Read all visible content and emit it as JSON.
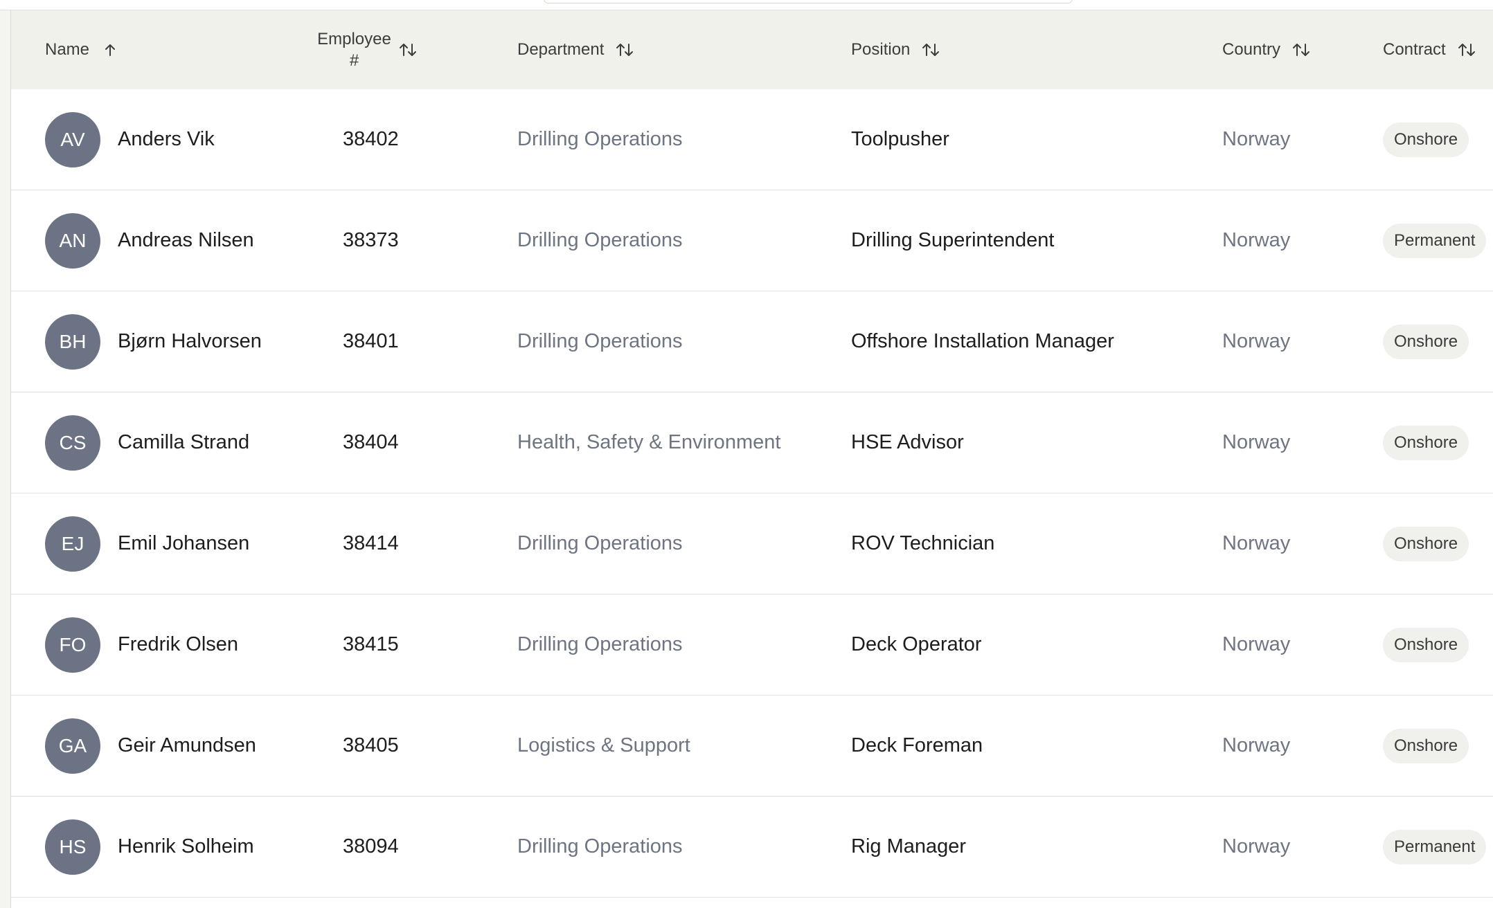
{
  "table": {
    "columns": [
      {
        "key": "name",
        "label": "Name",
        "sort": "asc"
      },
      {
        "key": "employee_no",
        "label_line1": "Employee",
        "label_line2": "#",
        "sort": "none"
      },
      {
        "key": "department",
        "label": "Department",
        "sort": "none"
      },
      {
        "key": "position",
        "label": "Position",
        "sort": "none"
      },
      {
        "key": "country",
        "label": "Country",
        "sort": "none"
      },
      {
        "key": "contract",
        "label": "Contract",
        "sort": "none"
      }
    ],
    "rows": [
      {
        "initials": "AV",
        "name": "Anders Vik",
        "employee_no": "38402",
        "department": "Drilling Operations",
        "position": "Toolpusher",
        "country": "Norway",
        "contract": "Onshore"
      },
      {
        "initials": "AN",
        "name": "Andreas Nilsen",
        "employee_no": "38373",
        "department": "Drilling Operations",
        "position": "Drilling Superintendent",
        "country": "Norway",
        "contract": "Permanent"
      },
      {
        "initials": "BH",
        "name": "Bjørn Halvorsen",
        "employee_no": "38401",
        "department": "Drilling Operations",
        "position": "Offshore Installation Manager",
        "country": "Norway",
        "contract": "Onshore"
      },
      {
        "initials": "CS",
        "name": "Camilla Strand",
        "employee_no": "38404",
        "department": "Health, Safety & Environment",
        "position": "HSE Advisor",
        "country": "Norway",
        "contract": "Onshore"
      },
      {
        "initials": "EJ",
        "name": "Emil Johansen",
        "employee_no": "38414",
        "department": "Drilling Operations",
        "position": "ROV Technician",
        "country": "Norway",
        "contract": "Onshore"
      },
      {
        "initials": "FO",
        "name": "Fredrik Olsen",
        "employee_no": "38415",
        "department": "Drilling Operations",
        "position": "Deck Operator",
        "country": "Norway",
        "contract": "Onshore"
      },
      {
        "initials": "GA",
        "name": "Geir Amundsen",
        "employee_no": "38405",
        "department": "Logistics & Support",
        "position": "Deck Foreman",
        "country": "Norway",
        "contract": "Onshore"
      },
      {
        "initials": "HS",
        "name": "Henrik Solheim",
        "employee_no": "38094",
        "department": "Drilling Operations",
        "position": "Rig Manager",
        "country": "Norway",
        "contract": "Permanent"
      }
    ]
  },
  "icons": {
    "sort_asc": "arrow-up-icon",
    "sort_none": "arrows-up-down-icon"
  },
  "colors": {
    "avatar_bg": "#6b7385",
    "header_bg": "#f1f1ec",
    "badge_bg": "#f0f0ec",
    "muted_text": "#6e7482"
  }
}
